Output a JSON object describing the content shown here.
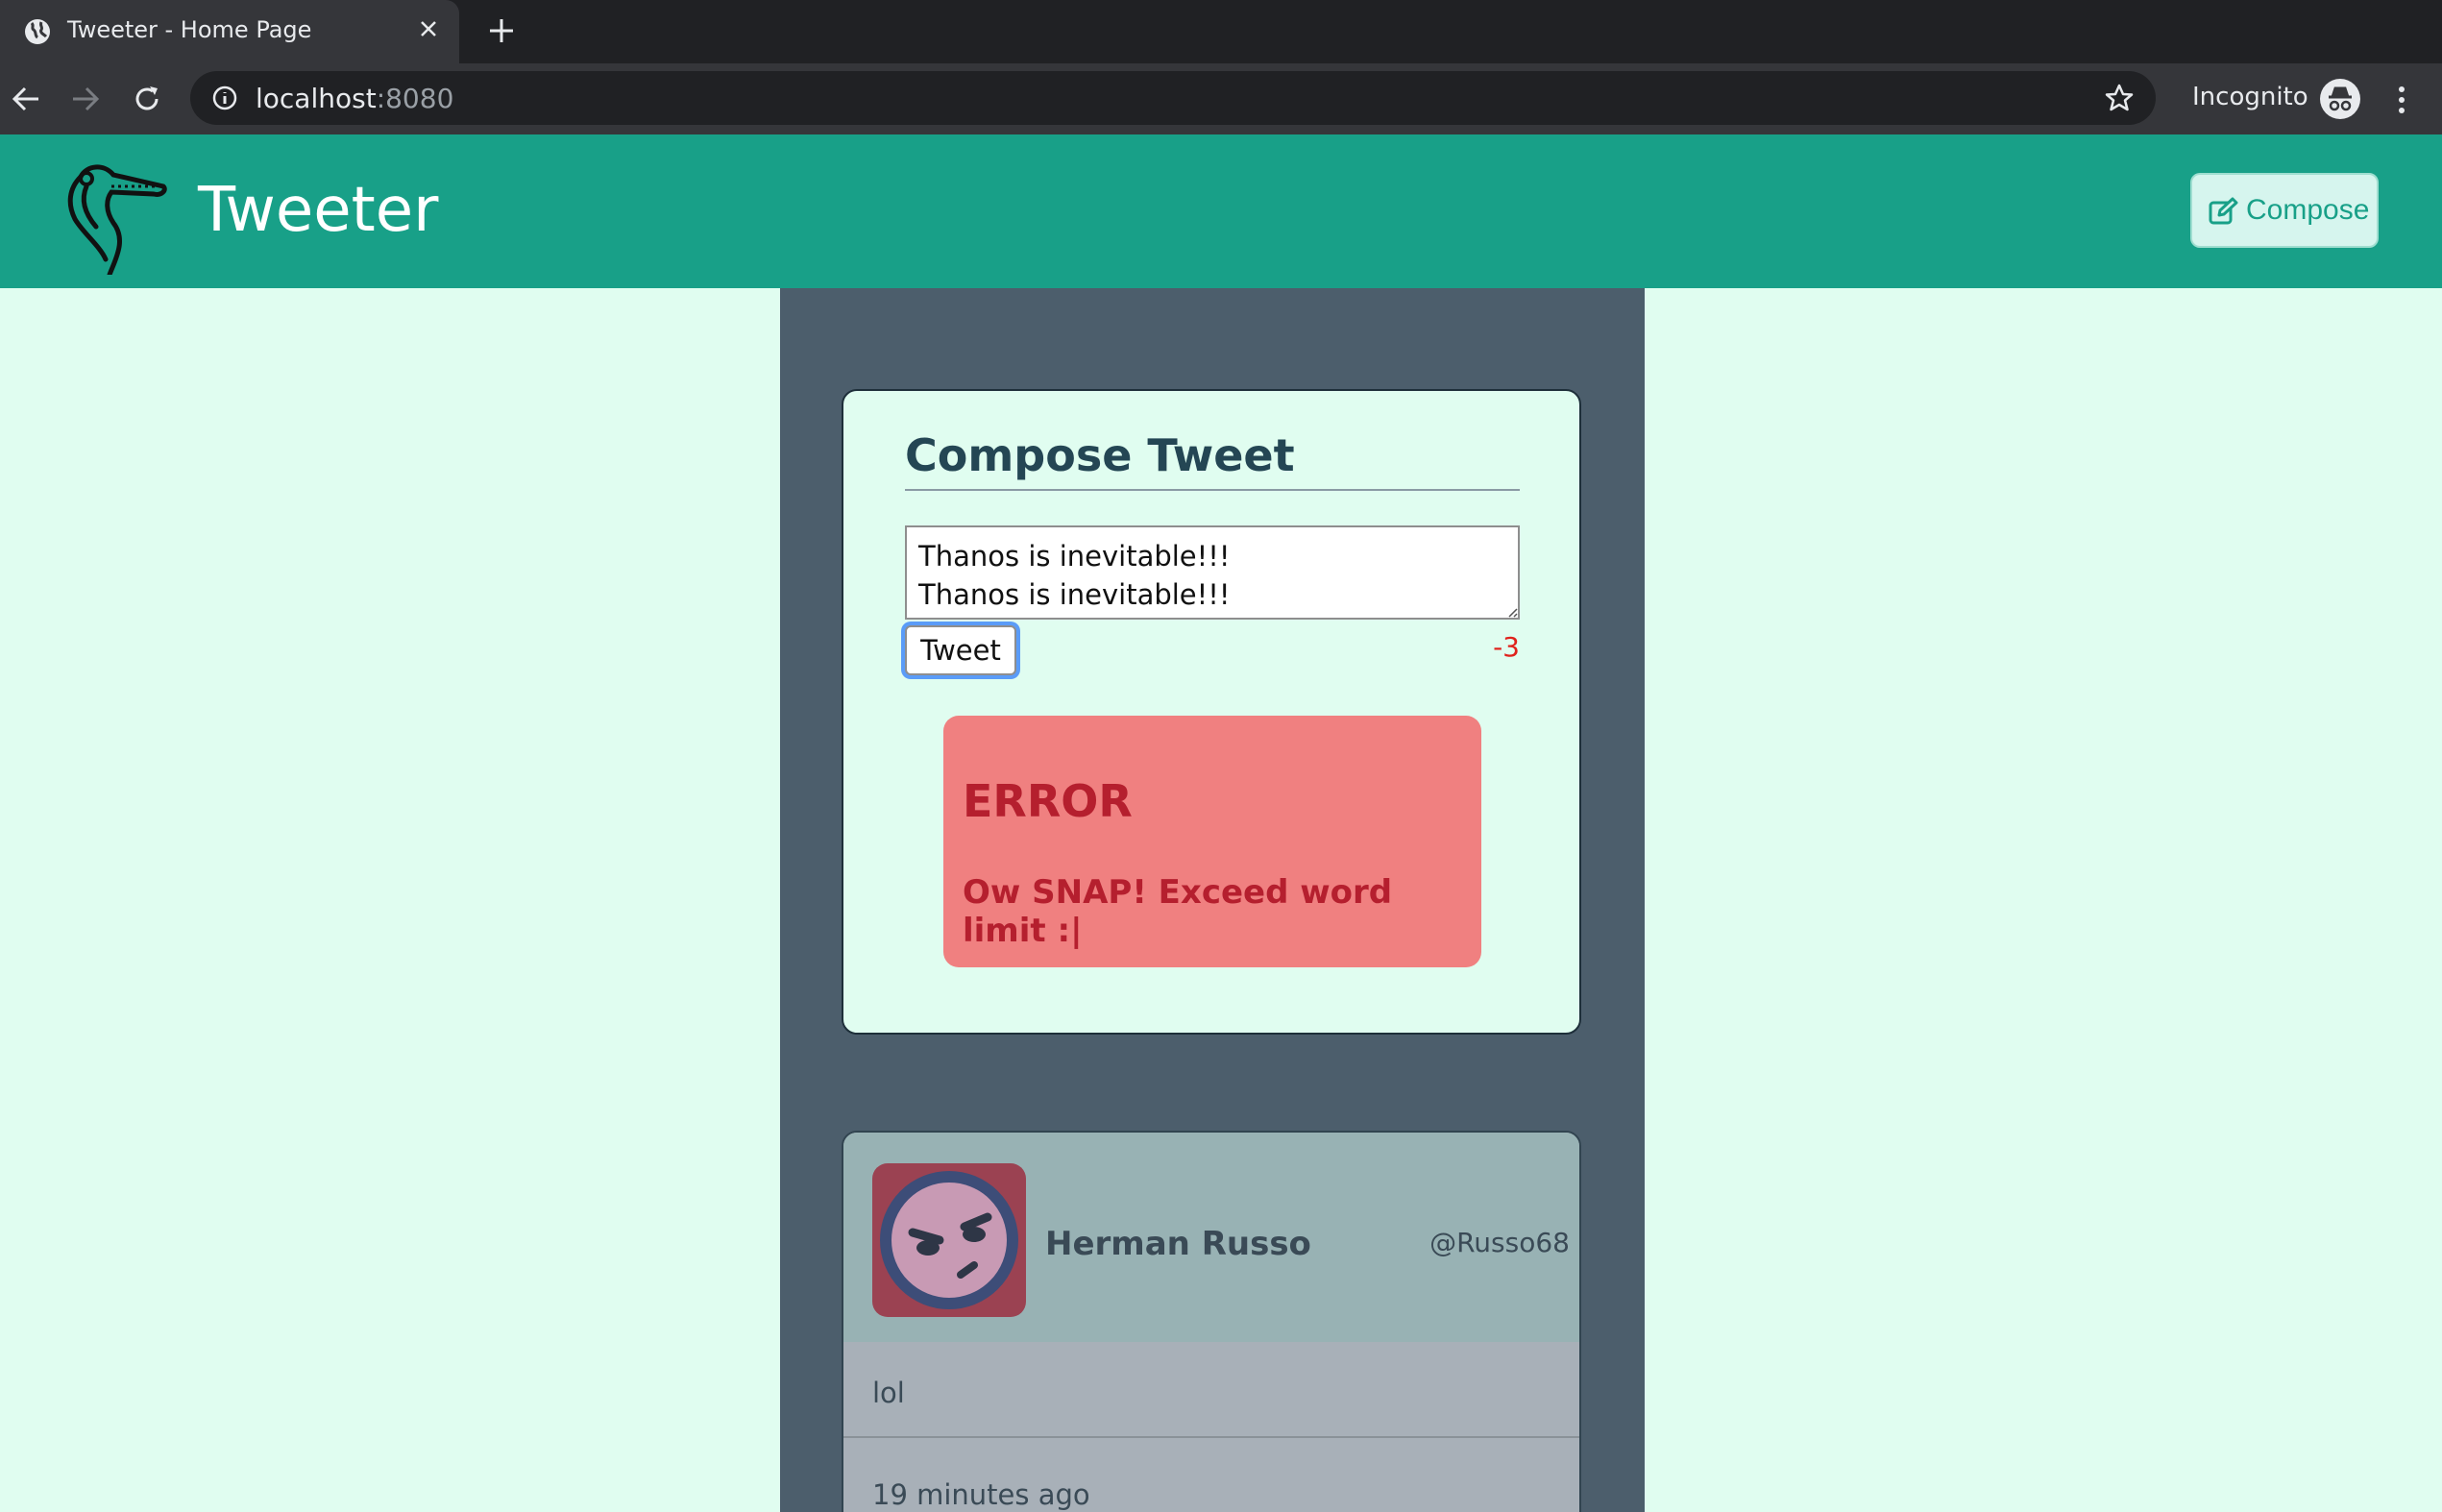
{
  "browser": {
    "tab_title": "Tweeter - Home Page",
    "url_host": "localhost",
    "url_port": ":8080",
    "incognito_label": "Incognito"
  },
  "header": {
    "brand": "Tweeter",
    "compose_label": "Compose",
    "bg_color": "#18a088"
  },
  "compose": {
    "title": "Compose Tweet",
    "textarea_value": "Thanos is inevitable!!!\nThanos is inevitable!!!",
    "tweet_button": "Tweet",
    "counter": "-3"
  },
  "error": {
    "heading": "ERROR",
    "message": "Ow SNAP! Exceed word limit :|"
  },
  "tweet": {
    "author": "Herman Russo",
    "handle": "@Russo68",
    "text": "lol",
    "time": "19 minutes ago"
  },
  "icons": {
    "tab_favicon": "globe-icon",
    "logo": "pelican-logo-icon",
    "compose": "edit-icon",
    "avatar": "angry-face-icon"
  }
}
